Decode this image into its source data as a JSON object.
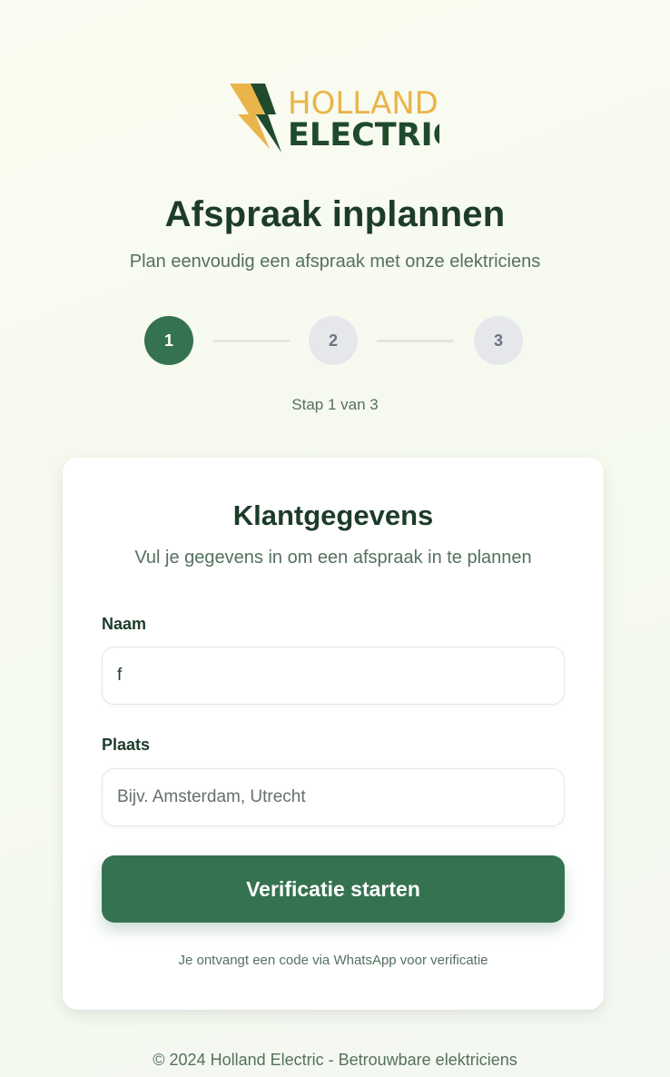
{
  "brand": {
    "line1": "HOLLAND",
    "line2": "ELECTRIC",
    "colors": {
      "yellow": "#e9b54a",
      "green": "#1f4a2c"
    }
  },
  "header": {
    "title": "Afspraak inplannen",
    "subtitle": "Plan eenvoudig een afspraak met onze elektriciens"
  },
  "steps": {
    "items": [
      "1",
      "2",
      "3"
    ],
    "active": 1,
    "label": "Stap 1 van 3"
  },
  "form": {
    "title": "Klantgegevens",
    "subtitle": "Vul je gegevens in om een afspraak in te plannen",
    "name_label": "Naam",
    "name_value": "f",
    "place_label": "Plaats",
    "place_placeholder": "Bijv. Amsterdam, Utrecht",
    "submit_label": "Verificatie starten",
    "hint": "Je ontvangt een code via WhatsApp voor verificatie"
  },
  "footer": {
    "text": "© 2024 Holland Electric - Betrouwbare elektriciens"
  },
  "colors": {
    "accent": "#357350",
    "inactive_step": "#e5e7eb",
    "text_dark": "#1d3b29",
    "text_muted": "#55705f"
  }
}
